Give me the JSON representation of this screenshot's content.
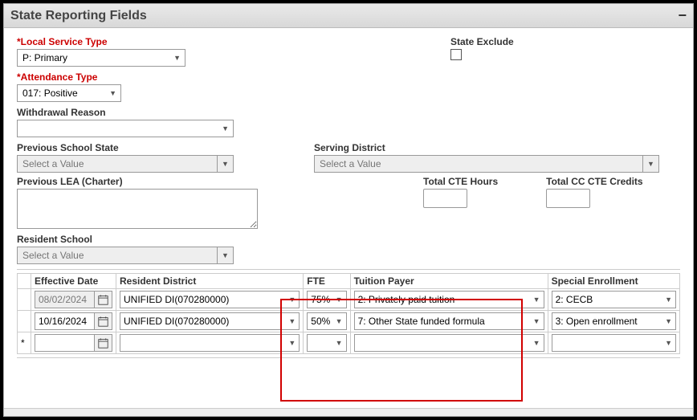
{
  "header": {
    "title": "State Reporting Fields"
  },
  "fields": {
    "local_service_type": {
      "label": "Local Service Type",
      "value": "P: Primary"
    },
    "state_exclude": {
      "label": "State Exclude",
      "checked": false
    },
    "attendance_type": {
      "label": "Attendance Type",
      "value": "017: Positive"
    },
    "withdrawal_reason": {
      "label": "Withdrawal Reason",
      "value": ""
    },
    "previous_school_state": {
      "label": "Previous School State",
      "placeholder": "Select a Value"
    },
    "serving_district": {
      "label": "Serving District",
      "placeholder": "Select a Value"
    },
    "previous_lea": {
      "label": "Previous LEA (Charter)",
      "value": ""
    },
    "total_cte_hours": {
      "label": "Total CTE Hours",
      "value": ""
    },
    "total_cc_cte_credits": {
      "label": "Total CC CTE Credits",
      "value": ""
    },
    "resident_school": {
      "label": "Resident School",
      "placeholder": "Select a Value"
    }
  },
  "grid": {
    "columns": {
      "effective_date": "Effective Date",
      "resident_district": "Resident District",
      "fte": "FTE",
      "tuition_payer": "Tuition Payer",
      "special_enrollment": "Special Enrollment"
    },
    "rows": [
      {
        "effective_date": "08/02/2024",
        "date_disabled": true,
        "resident_district": "UNIFIED DI(070280000)",
        "fte": "75%",
        "tuition_payer": "2: Privately paid tuition",
        "special_enrollment": "2: CECB"
      },
      {
        "effective_date": "10/16/2024",
        "date_disabled": false,
        "resident_district": "UNIFIED DI(070280000)",
        "fte": "50%",
        "tuition_payer": "7: Other State funded formula",
        "special_enrollment": "3: Open enrollment"
      },
      {
        "effective_date": "",
        "date_disabled": false,
        "resident_district": "",
        "fte": "",
        "tuition_payer": "",
        "special_enrollment": ""
      }
    ]
  }
}
